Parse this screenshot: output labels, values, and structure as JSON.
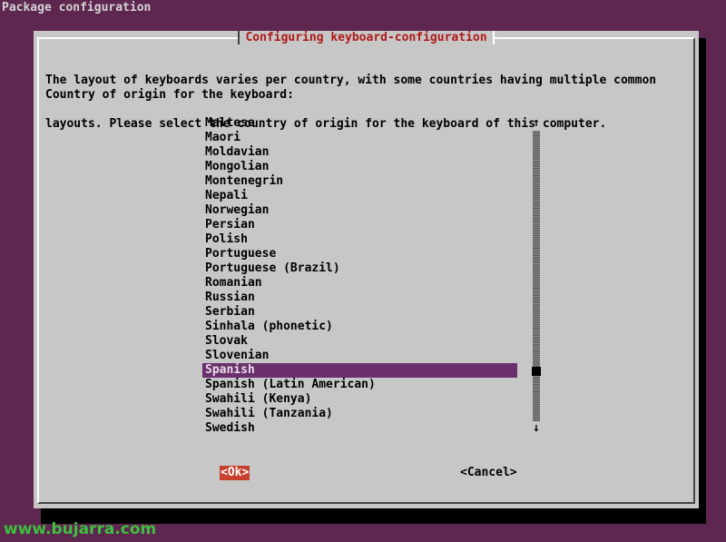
{
  "screen_title": "Package configuration",
  "dialog": {
    "title": "Configuring keyboard-configuration",
    "description_lines": [
      "The layout of keyboards varies per country, with some countries having multiple common",
      "layouts. Please select the country of origin for the keyboard of this computer."
    ],
    "prompt": "Country of origin for the keyboard:",
    "items": [
      "Maltese",
      "Maori",
      "Moldavian",
      "Mongolian",
      "Montenegrin",
      "Nepali",
      "Norwegian",
      "Persian",
      "Polish",
      "Portuguese",
      "Portuguese (Brazil)",
      "Romanian",
      "Russian",
      "Serbian",
      "Sinhala (phonetic)",
      "Slovak",
      "Slovenian",
      "Spanish",
      "Spanish (Latin American)",
      "Swahili (Kenya)",
      "Swahili (Tanzania)",
      "Swedish"
    ],
    "selected_item": "Spanish",
    "scroll_position": 0.84,
    "scroll_up_glyph": "↑",
    "scroll_down_glyph": "↓",
    "ok_label": "<Ok>",
    "cancel_label": "<Cancel>"
  },
  "watermark": "www.bujarra.com",
  "colors": {
    "desktop_background": "#5e2750",
    "dialog_background": "#c7c7c7",
    "title_text": "#b01818",
    "selection_background": "#6b2f6e",
    "ok_button_background": "#c8402e",
    "watermark_text": "#3fbf3f"
  }
}
